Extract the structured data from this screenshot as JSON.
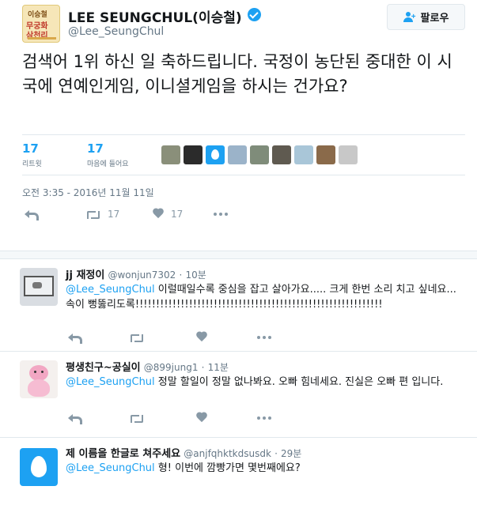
{
  "tweet": {
    "user_name": "LEE SEUNGCHUL(이승철)",
    "screen_name": "@Lee_SeungChul",
    "avatar_lines": [
      "이승철",
      "무궁화",
      "삼천리",
      ""
    ],
    "follow_label": "팔로우",
    "text": "검색어 1위 하신 일 축하드립니다. 국정이 농단된 중대한 이 시국에 연예인게임, 이니셜게임을 하시는 건가요?",
    "retweets_count": "17",
    "retweets_label": "리트윗",
    "likes_count": "17",
    "likes_label": "마음에 들어요",
    "timestamp": "오전 3:35 - 2016년 11월 11일",
    "action_retweet_count": "17",
    "action_like_count": "17"
  },
  "likers": [
    {
      "icon": "liker-avatar-1",
      "color": "#8a8f7a"
    },
    {
      "icon": "liker-avatar-panda",
      "color": "#2b2b2b"
    },
    {
      "icon": "egg-avatar",
      "color": "#1da1f2"
    },
    {
      "icon": "liker-avatar-person",
      "color": "#9bb3c9"
    },
    {
      "icon": "liker-avatar-landscape",
      "color": "#7f8c7a"
    },
    {
      "icon": "liker-avatar-cat",
      "color": "#5f5a50"
    },
    {
      "icon": "liker-avatar-sky",
      "color": "#a9c6d8"
    },
    {
      "icon": "liker-avatar-brown",
      "color": "#8a6a4a"
    },
    {
      "icon": "liker-avatar-sketch",
      "color": "#c8c8c8"
    }
  ],
  "replies": [
    {
      "name": "jj 재정이",
      "handle": "@wonjun7302",
      "time": "10분",
      "mention": "@Lee_SeungChul",
      "text": " 이럴때일수록 중심을 잡고 살아가요..... 크게 한번 소리 치고 싶네요... 속이 뻥뚫리도록!!!!!!!!!!!!!!!!!!!!!!!!!!!!!!!!!!!!!!!!!!!!!!!!!!!!!!!!!!!!"
    },
    {
      "name": "평생친구~공실이",
      "handle": "@899jung1",
      "time": "11분",
      "mention": "@Lee_SeungChul",
      "text": " 정말 할일이 정말 없나봐요. 오빠 힘네세요. 진실은 오빠 편 입니다."
    },
    {
      "name": "제 이름을 한글로 쳐주세요",
      "handle": "@anjfqhktkdsusdk",
      "time": "29분",
      "mention": "@Lee_SeungChul",
      "text": " 형! 이번에 깜빵가면 몇번째에요?"
    }
  ],
  "colors": {
    "accent": "#1da1f2",
    "muted": "#657786",
    "icon": "#8899a6",
    "border": "#e1e8ed"
  }
}
